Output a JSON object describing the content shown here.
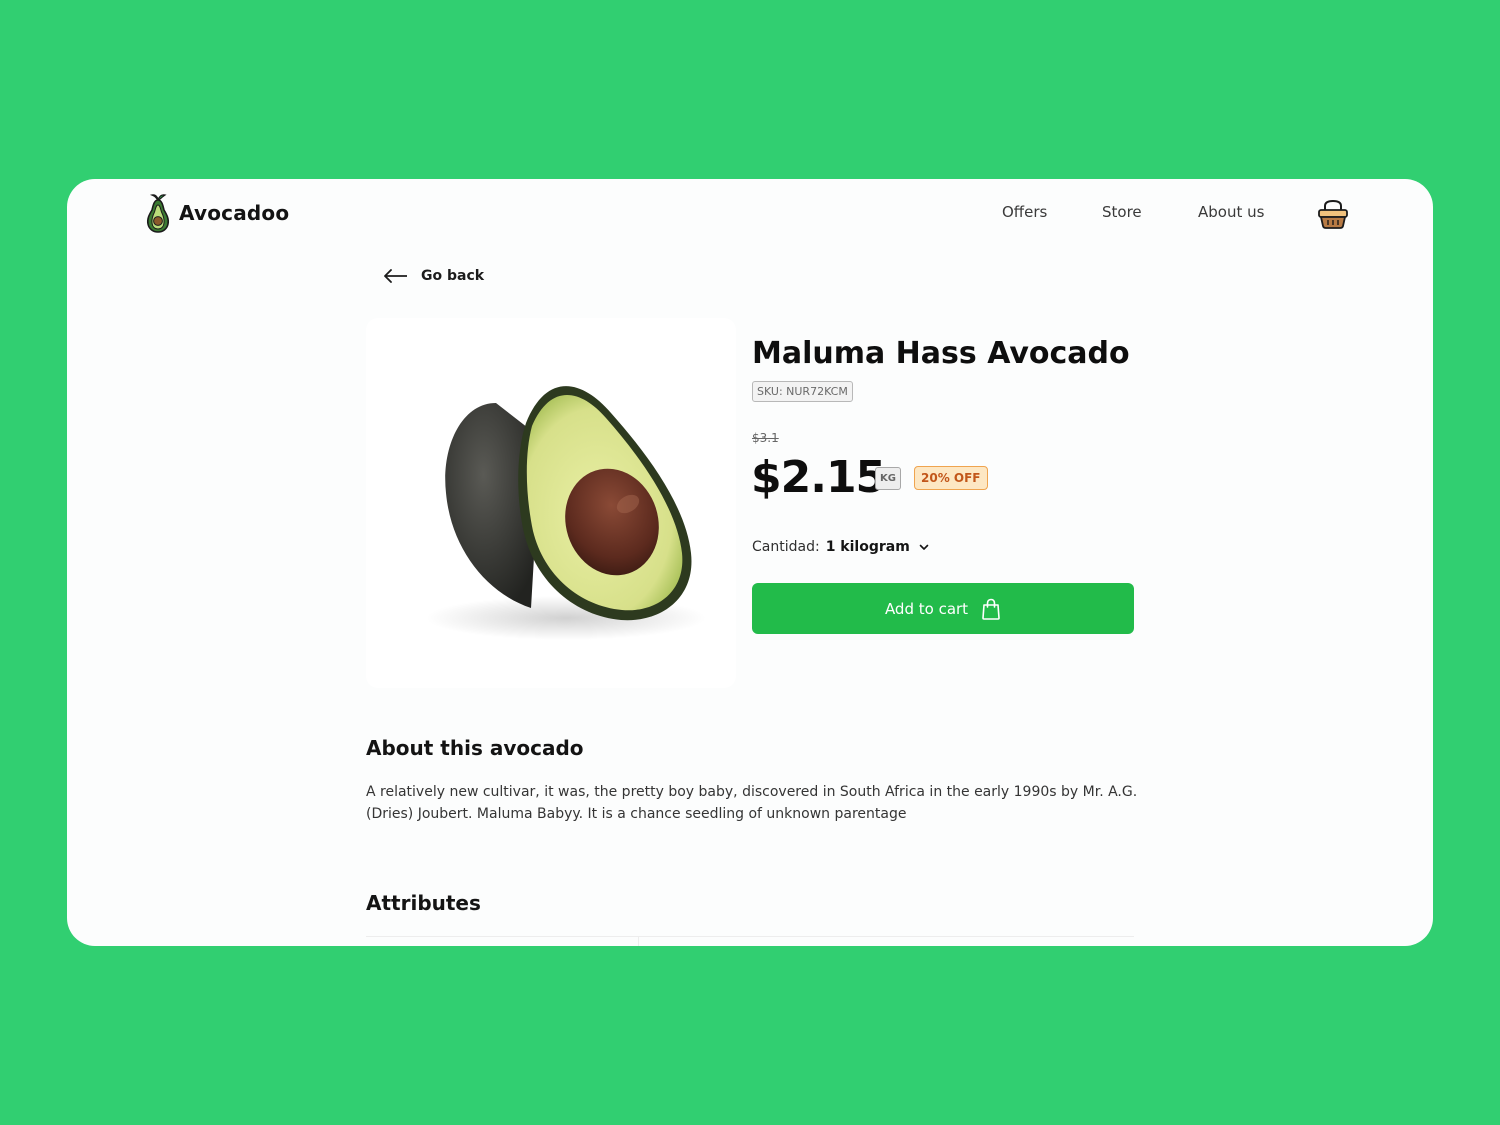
{
  "brand": {
    "name": "Avocadoo",
    "logo_icon": "avocado-icon"
  },
  "nav": {
    "items": [
      "Offers",
      "Store",
      "About us"
    ],
    "cart_icon": "basket-icon"
  },
  "back": {
    "label": "Go back",
    "icon": "arrow-left-icon"
  },
  "product": {
    "title": "Maluma Hass Avocado",
    "sku": "SKU: NUR72KCM",
    "old_price": "$3.1",
    "price": "$2.15",
    "unit": "KG",
    "discount": "20% OFF",
    "quantity_label": "Cantidad:",
    "quantity_value": "1 kilogram",
    "image_icon": "avocado-half-image"
  },
  "actions": {
    "add_to_cart": "Add to cart",
    "add_to_cart_icon": "shopping-bag-icon"
  },
  "about": {
    "heading": "About this avocado",
    "text": "A relatively new cultivar, it was, the pretty boy baby, discovered in South Africa in the early 1990s by Mr. A.G. (Dries) Joubert. Maluma Babyy. It is a chance seedling of unknown parentage"
  },
  "attributes": {
    "heading": "Attributes"
  },
  "colors": {
    "background": "#31cf71",
    "card": "#fcfdfd",
    "primary_button": "#22bb4a",
    "discount_text": "#c2561a",
    "discount_bg": "#fde7c3"
  }
}
